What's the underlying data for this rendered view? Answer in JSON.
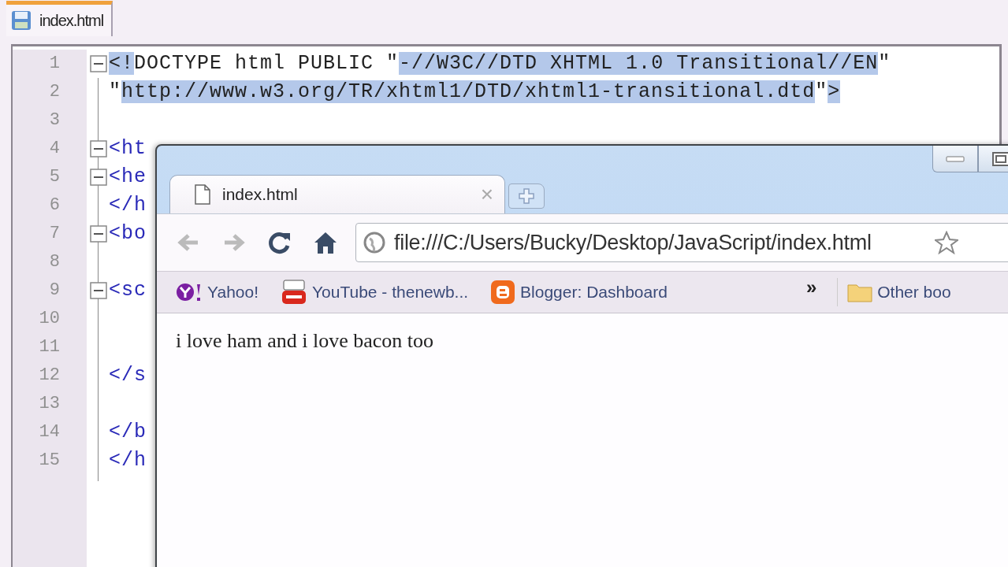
{
  "editor": {
    "tab": {
      "label": "index.html",
      "selected": true
    },
    "lines": [
      {
        "number": "1",
        "expanded": true,
        "segments": [
          {
            "text": "<!",
            "kind": "text",
            "selected": true
          },
          {
            "text": "DOCTYPE html PUBLIC \"",
            "kind": "text",
            "selected": false
          },
          {
            "text": "-//W3C//DTD XHTML 1.0 Transitional//EN",
            "kind": "text",
            "selected": true
          },
          {
            "text": "\"",
            "kind": "text",
            "selected": false
          }
        ]
      },
      {
        "number": "2",
        "segments": [
          {
            "text": "\"",
            "kind": "text",
            "selected": false
          },
          {
            "text": "http://www.w3.org/TR/xhtml1/DTD/xhtml1-transitional.dtd",
            "kind": "text",
            "selected": true
          },
          {
            "text": "\"",
            "kind": "text",
            "selected": false
          },
          {
            "text": ">",
            "kind": "text",
            "selected": true
          }
        ]
      },
      {
        "number": "3"
      },
      {
        "number": "4",
        "expanded": true,
        "segments": [
          {
            "text": "<ht",
            "kind": "tag",
            "selected": false
          }
        ]
      },
      {
        "number": "5",
        "expanded": true,
        "segments": [
          {
            "text": "<he",
            "kind": "tag",
            "selected": false
          }
        ]
      },
      {
        "number": "6",
        "segments": [
          {
            "text": "</h",
            "kind": "tag",
            "selected": false
          }
        ]
      },
      {
        "number": "7",
        "expanded": true,
        "segments": [
          {
            "text": "<bo",
            "kind": "tag",
            "selected": false
          }
        ]
      },
      {
        "number": "8"
      },
      {
        "number": "9",
        "expanded": true,
        "segments": [
          {
            "text": "<sc",
            "kind": "tag",
            "selected": false
          }
        ]
      },
      {
        "number": "10"
      },
      {
        "number": "11"
      },
      {
        "number": "12",
        "segments": [
          {
            "text": "</s",
            "kind": "tag",
            "selected": false
          }
        ]
      },
      {
        "number": "13"
      },
      {
        "number": "14",
        "segments": [
          {
            "text": "</b",
            "kind": "tag",
            "selected": false
          }
        ]
      },
      {
        "number": "15",
        "segments": [
          {
            "text": "</h",
            "kind": "tag",
            "selected": false
          }
        ]
      }
    ]
  },
  "browser": {
    "tab": {
      "title": "index.html",
      "close": "×",
      "selected": true
    },
    "back_disabled": true,
    "forward_disabled": true,
    "address": "file:///C:/Users/Bucky/Desktop/JavaScript/index.html",
    "bookmarks": [
      {
        "label": "Yahoo!",
        "kind": "yahoo"
      },
      {
        "label": "YouTube - thenewb...",
        "kind": "youtube"
      },
      {
        "label": "Blogger: Dashboard",
        "kind": "blogger"
      }
    ],
    "overflow": "»",
    "other_bookmarks": "Other boo",
    "content": "i love ham and i love bacon too"
  }
}
